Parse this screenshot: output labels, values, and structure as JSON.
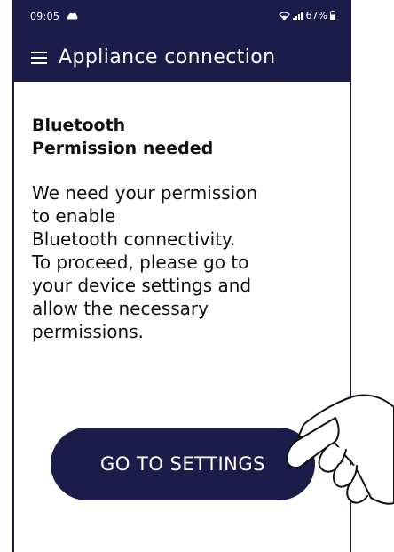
{
  "status_bar": {
    "time": "09:05",
    "battery": "67%"
  },
  "app_bar": {
    "title": "Appliance connection",
    "menu_icon": "hamburger-menu-icon"
  },
  "content": {
    "heading_lines": [
      "Bluetooth",
      "Permission needed"
    ],
    "body_lines": [
      "We need your permission",
      "to enable",
      "Bluetooth connectivity.",
      "To proceed, please go to",
      "your device settings and",
      "allow the necessary",
      "permissions."
    ]
  },
  "button": {
    "label": "GO TO SETTINGS"
  },
  "colors": {
    "primary": "#1c1c4a",
    "text": "#111111",
    "background": "#ffffff"
  }
}
